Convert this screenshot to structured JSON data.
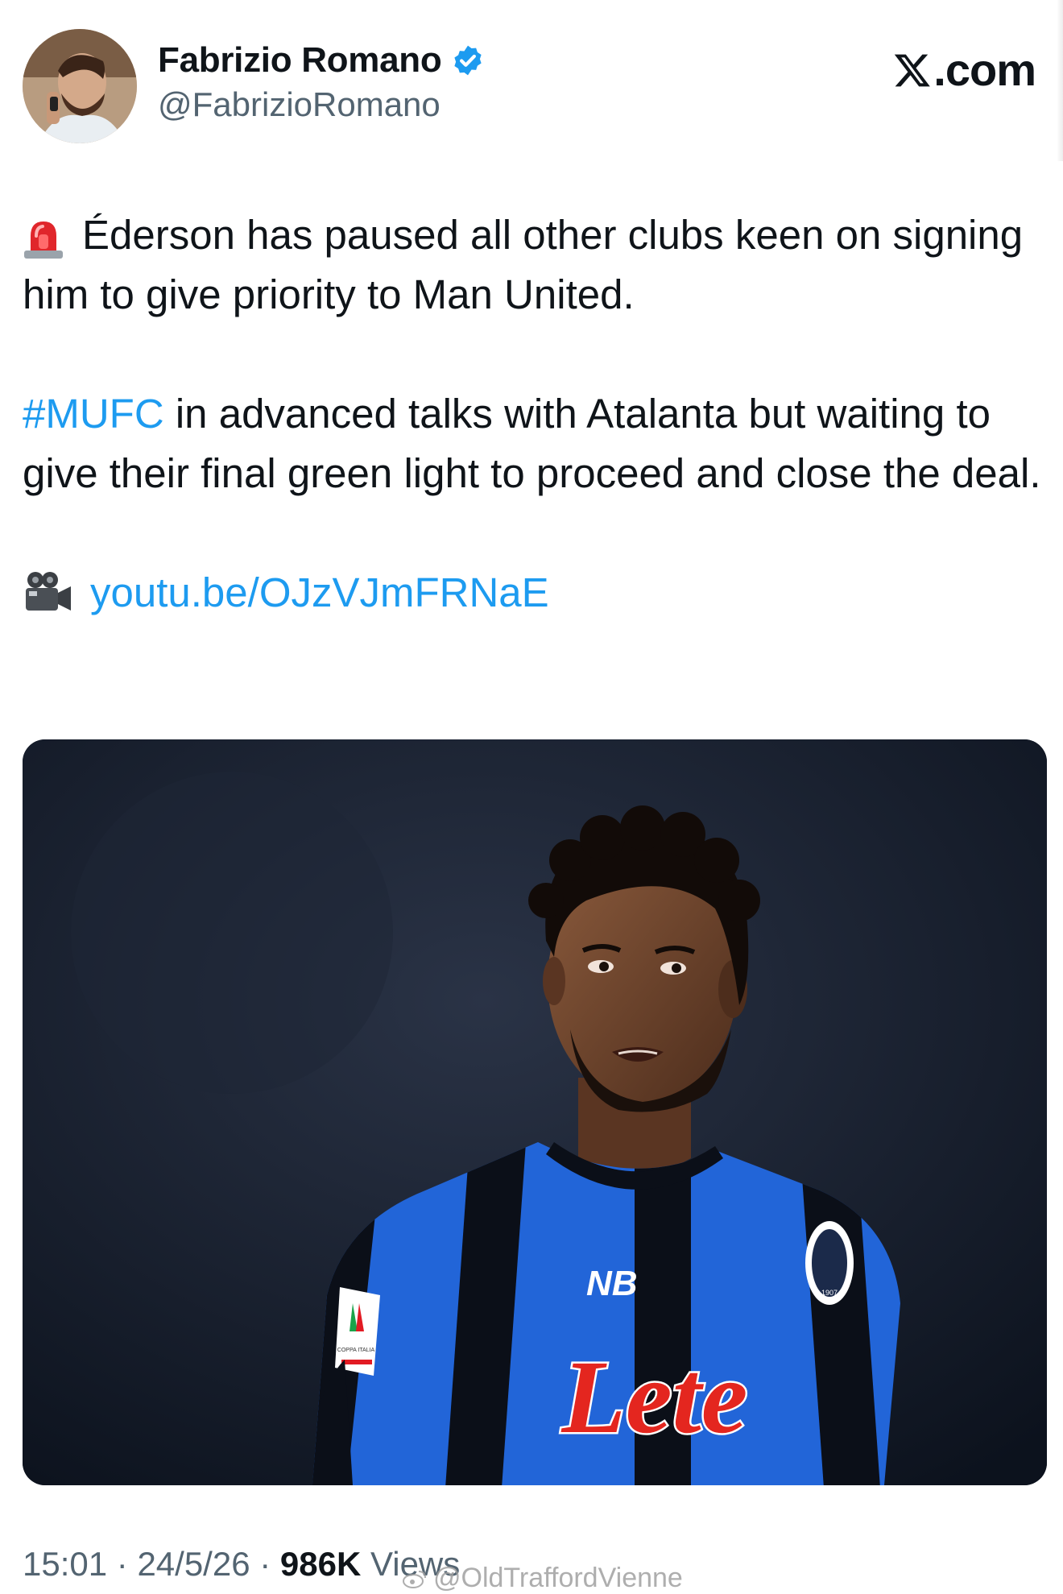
{
  "author": {
    "display_name": "Fabrizio Romano",
    "handle": "@FabrizioRomano",
    "verified": true
  },
  "brand": {
    "label": ".com",
    "icon": "x-logo-icon"
  },
  "tweet": {
    "para1": "Éderson has paused all other clubs keen on signing him to give priority to Man United.",
    "para1_icon": "siren-emoji-icon",
    "para2_hashtag": "#MUFC",
    "para2_rest": " in advanced talks with Atalanta but waiting to give their final green light to proceed and close the deal.",
    "link_icon": "movie-camera-emoji-icon",
    "link": "youtu.be/OJzVJmFRNaE"
  },
  "media": {
    "description_icon": "player-photo",
    "sponsor_text": "Lete",
    "kit_brand": "NB",
    "badge_year": "1907",
    "patch_text": "COPPA ITALIA"
  },
  "meta": {
    "time": "15:01",
    "sep": " · ",
    "date": "24/5/26",
    "views_count": "986K",
    "views_label": " Views"
  },
  "watermark": "@OldTraffordVienne",
  "colors": {
    "link": "#1d9bf0",
    "text": "#0f1419",
    "secondary": "#536471",
    "verified": "#1d9bf0"
  }
}
